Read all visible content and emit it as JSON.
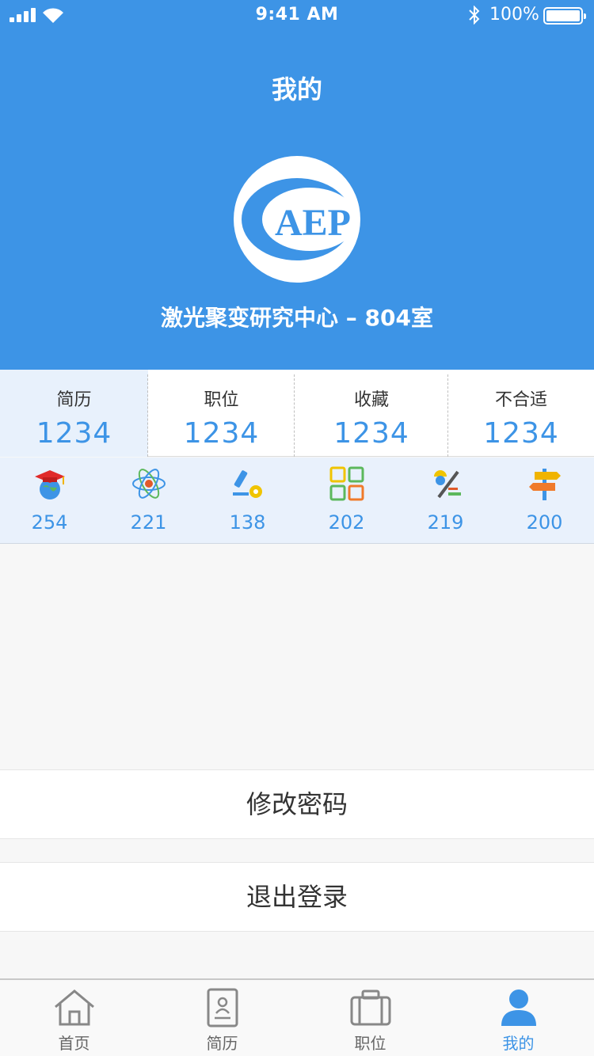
{
  "status_bar": {
    "time": "9:41 AM",
    "battery_text": "100%"
  },
  "header": {
    "title": "我的",
    "organization": "激光聚变研究中心 – 804室",
    "logo_text": "AEP"
  },
  "stats": [
    {
      "label": "简历",
      "value": "1234"
    },
    {
      "label": "职位",
      "value": "1234"
    },
    {
      "label": "收藏",
      "value": "1234"
    },
    {
      "label": "不合适",
      "value": "1234"
    }
  ],
  "categories": [
    {
      "icon": "graduation-globe-icon",
      "value": "254"
    },
    {
      "icon": "atom-icon",
      "value": "221"
    },
    {
      "icon": "microscope-gear-icon",
      "value": "138"
    },
    {
      "icon": "grid-squares-icon",
      "value": "202"
    },
    {
      "icon": "engineer-tools-icon",
      "value": "219"
    },
    {
      "icon": "signpost-icon",
      "value": "200"
    }
  ],
  "menu": {
    "change_password": "修改密码",
    "logout": "退出登录"
  },
  "tabs": [
    {
      "label": "首页",
      "icon": "home-icon"
    },
    {
      "label": "简历",
      "icon": "resume-icon"
    },
    {
      "label": "职位",
      "icon": "briefcase-icon"
    },
    {
      "label": "我的",
      "icon": "user-icon"
    }
  ],
  "colors": {
    "primary": "#3d94e6",
    "active_tab": "#3d94e6",
    "inactive_tab": "#888888"
  }
}
